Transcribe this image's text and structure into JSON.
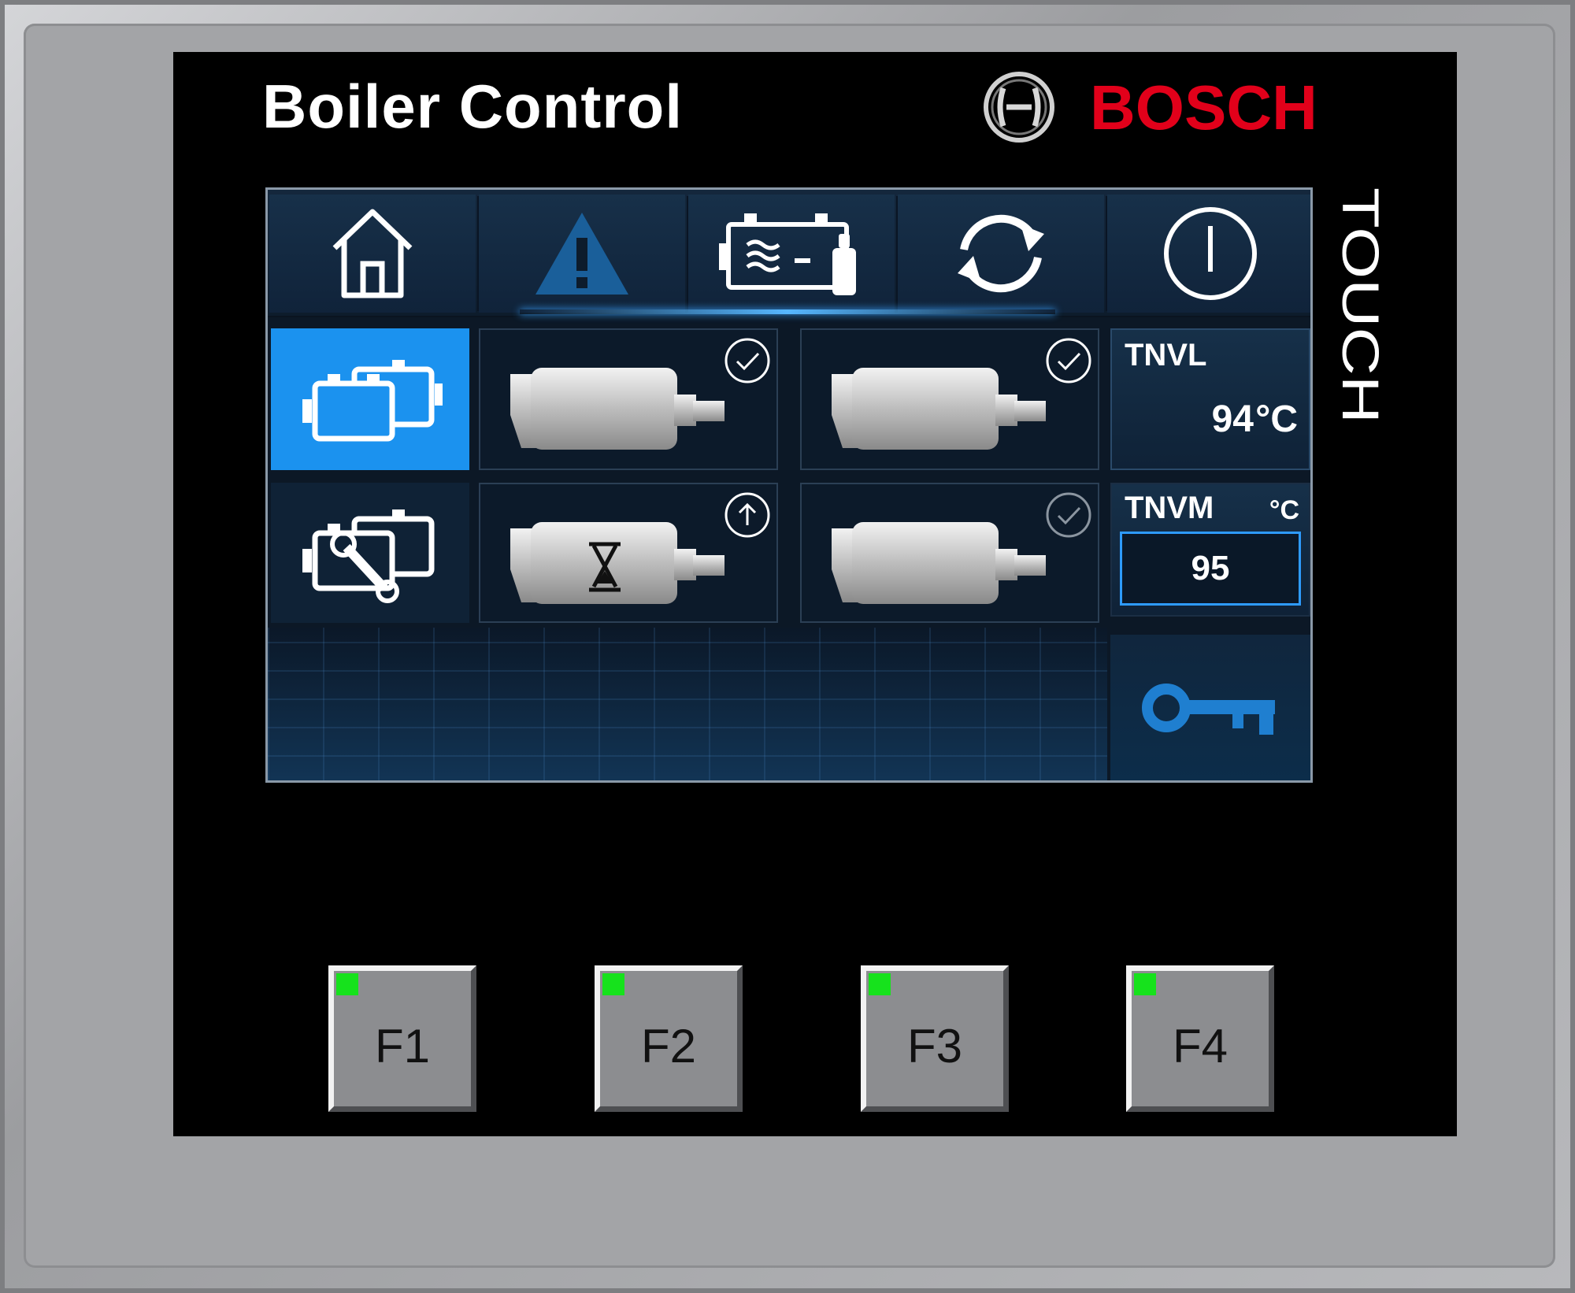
{
  "panel": {
    "title": "Boiler Control",
    "brand": "BOSCH",
    "touch_label": "TOUCH"
  },
  "colors": {
    "brand_red": "#e2001a",
    "screen_accent_blue": "#1b92ef",
    "led_green": "#16e21c"
  },
  "nav": {
    "items": [
      {
        "name": "home",
        "icon": "house-icon"
      },
      {
        "name": "alarms",
        "icon": "warning-triangle-icon"
      },
      {
        "name": "boiler-equipment",
        "icon": "boiler-heater-icon"
      },
      {
        "name": "refresh",
        "icon": "refresh-arrows-icon"
      },
      {
        "name": "power",
        "icon": "power-icon"
      }
    ]
  },
  "side_menu": {
    "items": [
      {
        "name": "boilers-overview",
        "icon": "boilers-icon",
        "active": true
      },
      {
        "name": "service",
        "icon": "boilers-wrench-icon",
        "active": false
      }
    ]
  },
  "boilers": [
    {
      "status": "ok",
      "badge_icon": "check-circle-icon"
    },
    {
      "status": "ok",
      "badge_icon": "check-circle-icon"
    },
    {
      "status": "waiting",
      "badge_icon": "arrow-up-circle-icon",
      "body_icon": "hourglass-icon"
    },
    {
      "status": "ok-dim",
      "badge_icon": "check-circle-icon"
    }
  ],
  "tnvl": {
    "label": "TNVL",
    "value": "94",
    "unit": "°C"
  },
  "tnvm": {
    "label": "TNVM",
    "unit": "°C",
    "value": "95"
  },
  "lock": {
    "icon": "key-icon"
  },
  "function_keys": [
    {
      "label": "F1",
      "led": "on"
    },
    {
      "label": "F2",
      "led": "on"
    },
    {
      "label": "F3",
      "led": "on"
    },
    {
      "label": "F4",
      "led": "on"
    }
  ]
}
